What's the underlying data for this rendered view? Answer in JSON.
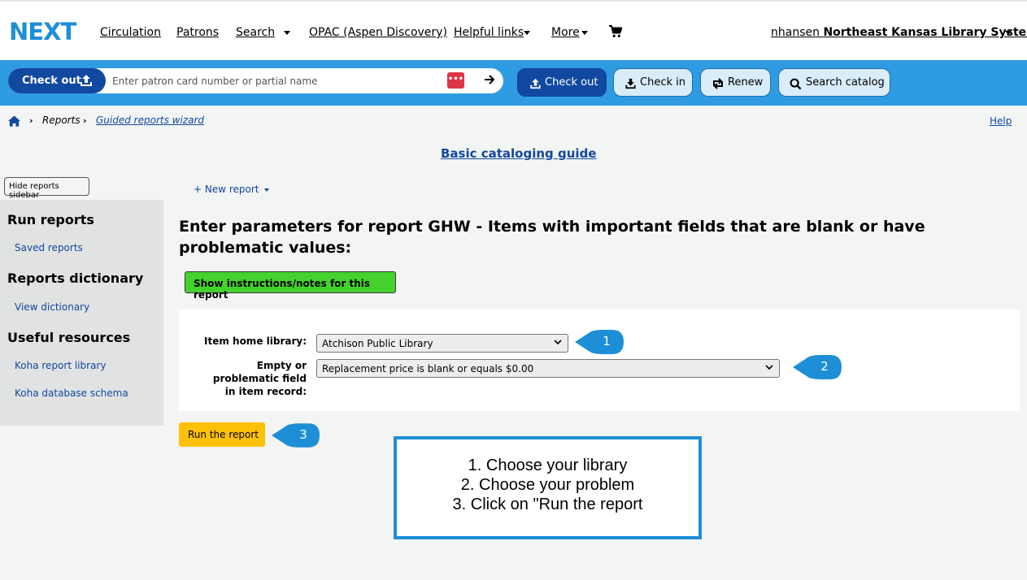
{
  "header": {
    "logo": "NEXT",
    "nav": [
      {
        "label": "Circulation"
      },
      {
        "label": "Patrons"
      },
      {
        "label": "Search"
      },
      {
        "label": "OPAC (Aspen Discovery)"
      },
      {
        "label": "Helpful links"
      },
      {
        "label": "More"
      }
    ],
    "cart_icon": "cart-icon",
    "user": "nhansen",
    "library": "Northeast Kansas Library System"
  },
  "toolbar": {
    "checkout_pill": "Check out",
    "patron_placeholder": "Enter patron card number or partial name",
    "dots": "•••",
    "buttons": [
      {
        "label": "Check out",
        "icon": "upload-icon"
      },
      {
        "label": "Check in",
        "icon": "download-icon"
      },
      {
        "label": "Renew",
        "icon": "renew-icon"
      },
      {
        "label": "Search catalog",
        "icon": "search-icon"
      }
    ]
  },
  "breadcrumb": {
    "home_icon": "home-icon",
    "items": [
      "Reports",
      "Guided reports wizard"
    ],
    "help": "Help"
  },
  "guide_link": "Basic cataloging guide",
  "sidebar": {
    "hide_button": "Hide reports sidebar",
    "sections": [
      {
        "heading": "Run reports",
        "links": [
          "Saved reports"
        ]
      },
      {
        "heading": "Reports dictionary",
        "links": [
          "View dictionary"
        ]
      },
      {
        "heading": "Useful resources",
        "links": [
          "Koha report library",
          "Koha database schema"
        ]
      }
    ]
  },
  "main": {
    "new_report": "+ New report",
    "title": "Enter parameters for report GHW - Items with important fields that are blank or have problematic values:",
    "instructions_button": "Show instructions/notes for this report",
    "fields": [
      {
        "label": "Item home library:",
        "value": "Atchison Public Library"
      },
      {
        "label": "Empty or problematic field in item record:",
        "value": "Replacement price is blank or equals $0.00"
      }
    ],
    "run_button": "Run the report"
  },
  "callouts": [
    "1",
    "2",
    "3"
  ],
  "notes": [
    "1. Choose your library",
    "2. Choose your problem",
    "3. Click on \"Run the report"
  ],
  "colors": {
    "brand_blue": "#2f9be0",
    "dark_blue": "#1148a0",
    "callout_blue": "#1e8fd6",
    "green_button": "#45d22f",
    "run_button": "#ffc107"
  }
}
